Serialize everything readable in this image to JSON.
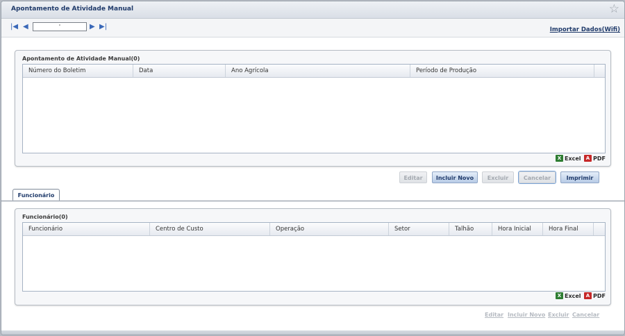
{
  "window": {
    "title": "Apontamento de Atividade Manual"
  },
  "navigation": {
    "first_icon": "first-page-icon",
    "prev_icon": "prev-page-icon",
    "next_icon": "next-page-icon",
    "last_icon": "last-page-icon",
    "record_value": "'",
    "import_link": "Importar Dados(Wifi)"
  },
  "main_panel": {
    "title": "Apontamento de Atividade Manual(0)",
    "columns": [
      "Número do Boletim",
      "Data",
      "Ano Agrícola",
      "Período de Produção"
    ],
    "rows": [],
    "export_excel": "Excel",
    "export_pdf": "PDF"
  },
  "toolbar": {
    "edit": "Editar",
    "new": "Incluir Novo",
    "delete": "Excluir",
    "cancel": "Cancelar",
    "print": "Imprimir"
  },
  "tabs": [
    {
      "label": "Funcionário",
      "active": true
    }
  ],
  "employee_panel": {
    "title": "Funcionário(0)",
    "columns": [
      "Funcionário",
      "Centro de Custo",
      "Operação",
      "Setor",
      "Talhão",
      "Hora Inicial",
      "Hora Final"
    ],
    "rows": [],
    "export_excel": "Excel",
    "export_pdf": "PDF"
  },
  "employee_actions": {
    "edit": "Editar",
    "new": "Incluir Novo",
    "delete": "Excluir",
    "cancel": "Cancelar"
  },
  "colors": {
    "title_text": "#1f3a6a",
    "nav_icon": "#3a68b8",
    "excel": "#2e7d32",
    "pdf": "#c62828"
  }
}
